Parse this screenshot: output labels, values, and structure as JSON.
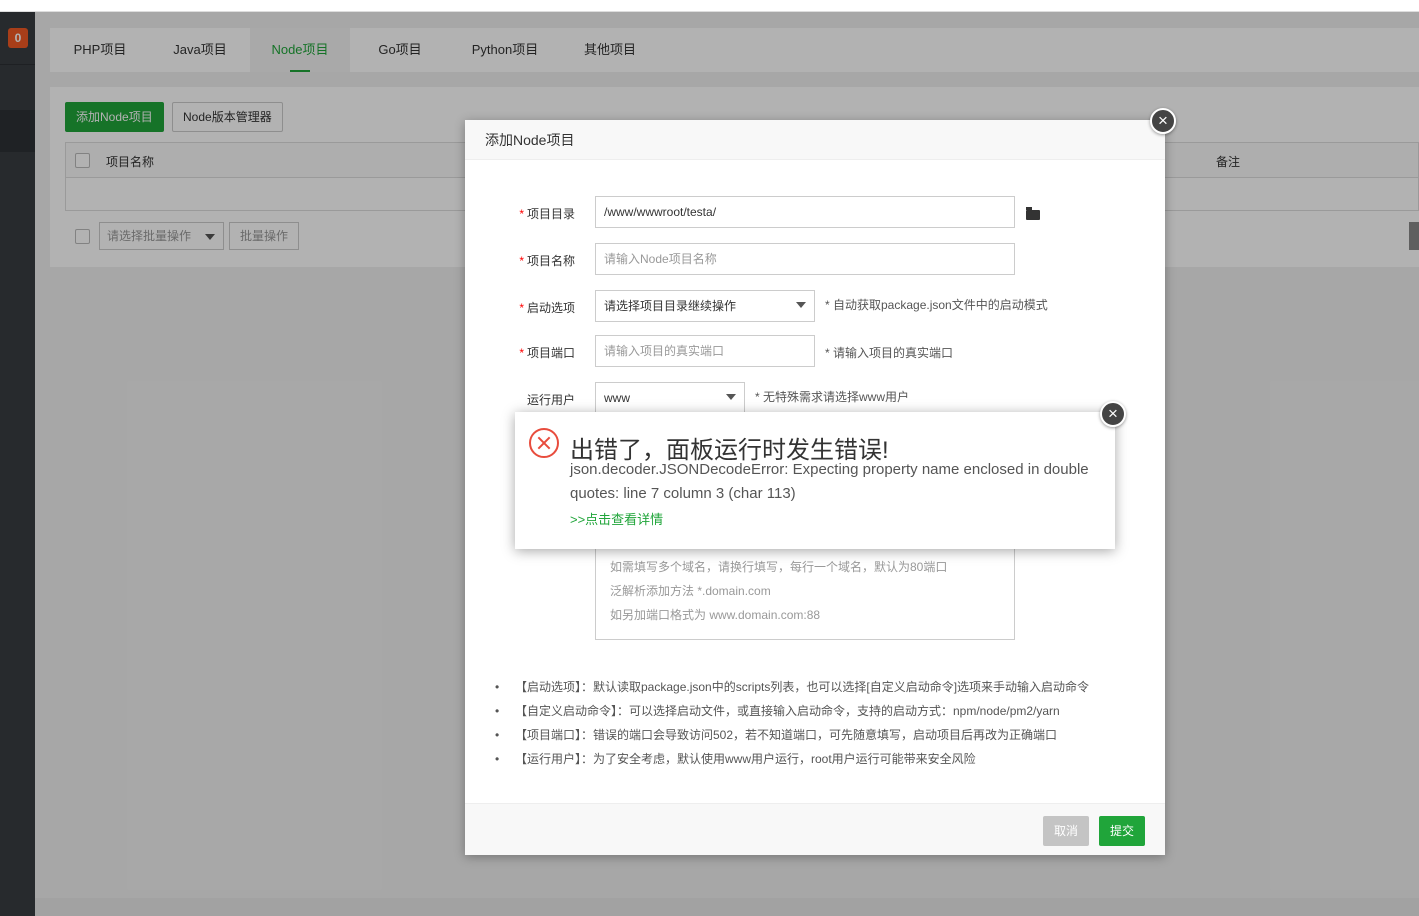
{
  "sidebar": {
    "badge": "0"
  },
  "tabs": [
    {
      "label": "PHP项目"
    },
    {
      "label": "Java项目"
    },
    {
      "label": "Node项目"
    },
    {
      "label": "Go项目"
    },
    {
      "label": "Python项目"
    },
    {
      "label": "其他项目"
    }
  ],
  "toolbar": {
    "add_label": "添加Node项目",
    "version_label": "Node版本管理器"
  },
  "table": {
    "col_name": "项目名称",
    "col_note": "备注"
  },
  "batch": {
    "select_placeholder": "请选择批量操作",
    "button_label": "批量操作"
  },
  "dialog": {
    "title": "添加Node项目",
    "fields": {
      "dir": {
        "label": "项目目录",
        "value": "/www/wwwroot/testa/"
      },
      "name": {
        "label": "项目名称",
        "placeholder": "请输入Node项目名称"
      },
      "start": {
        "label": "启动选项",
        "value": "请选择项目目录继续操作",
        "hint": "* 自动获取package.json文件中的启动模式"
      },
      "port": {
        "label": "项目端口",
        "placeholder": "请输入项目的真实端口",
        "hint": "* 请输入项目的真实端口"
      },
      "user": {
        "label": "运行用户",
        "value": "www",
        "hint": "* 无特殊需求请选择www用户"
      }
    },
    "domain_lines": [
      "如需填写多个域名，请换行填写，每行一个域名，默认为80端口",
      "泛解析添加方法 *.domain.com",
      "如另加端口格式为 www.domain.com:88"
    ],
    "tips": [
      "【启动选项】：默认读取package.json中的scripts列表，也可以选择[自定义启动命令]选项来手动输入启动命令",
      "【自定义启动命令】：可以选择启动文件，或直接输入启动命令，支持的启动方式：npm/node/pm2/yarn",
      "【项目端口】：错误的端口会导致访问502，若不知道端口，可先随意填写，启动项目后再改为正确端口",
      "【运行用户】：为了安全考虑，默认使用www用户运行，root用户运行可能带来安全风险"
    ],
    "cancel_label": "取消",
    "submit_label": "提交"
  },
  "error": {
    "title": "出错了，面板运行时发生错误!",
    "message": "json.decoder.JSONDecodeError: Expecting property name enclosed in double quotes: line 7 column 3 (char 113)",
    "link": ">>点击查看详情"
  },
  "colors": {
    "accent": "#20a53a",
    "error": "#e84c3d",
    "sidebar": "#383d41"
  }
}
